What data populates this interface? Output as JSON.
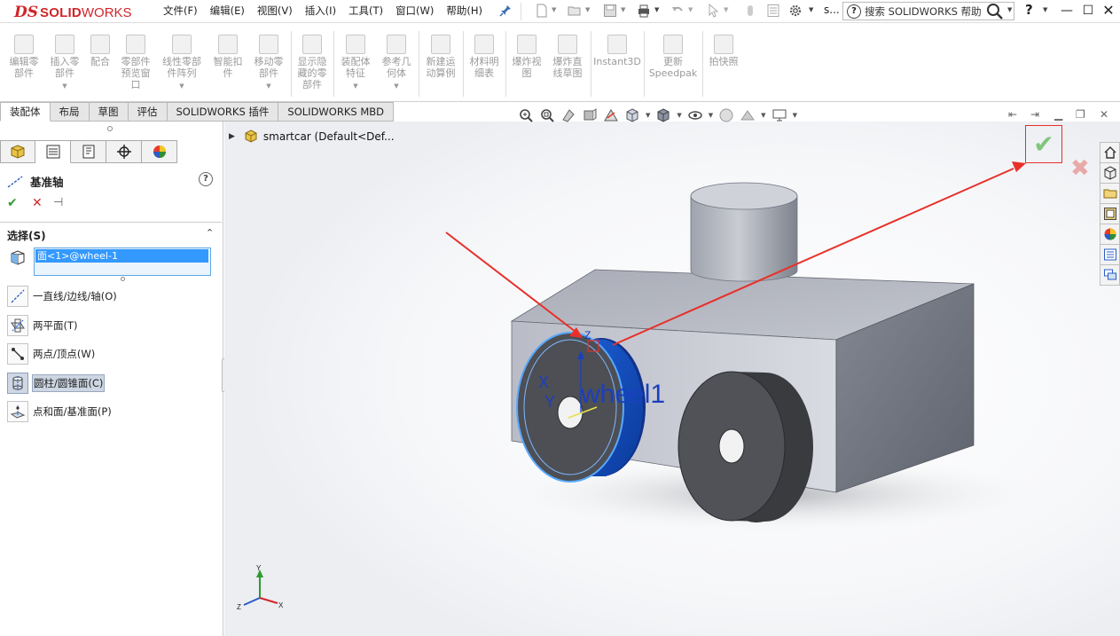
{
  "app": {
    "logo_prefix": "DS",
    "logo_bold": "SOLID",
    "logo_rest": "WORKS"
  },
  "menu": [
    "文件(F)",
    "编辑(E)",
    "视图(V)",
    "插入(I)",
    "工具(T)",
    "窗口(W)",
    "帮助(H)"
  ],
  "titlebar": {
    "doc_short": "s...",
    "search_label": "搜索 SOLIDWORKS 帮助",
    "help_glyph": "?"
  },
  "commands": [
    {
      "label": "编辑零\n部件",
      "dropdown": false
    },
    {
      "label": "插入零\n部件",
      "dropdown": true
    },
    {
      "label": "配合",
      "dropdown": false
    },
    {
      "label": "零部件\n预览窗\n口",
      "dropdown": false
    },
    {
      "label": "线性零部\n件阵列",
      "dropdown": true
    },
    {
      "label": "智能扣\n件",
      "dropdown": false
    },
    {
      "label": "移动零\n部件",
      "dropdown": true
    },
    {
      "label": "显示隐\n藏的零\n部件",
      "dropdown": false
    },
    {
      "label": "装配体\n特征",
      "dropdown": true
    },
    {
      "label": "参考几\n何体",
      "dropdown": true
    },
    {
      "label": "新建运\n动算例",
      "dropdown": false
    },
    {
      "label": "材料明\n细表",
      "dropdown": false
    },
    {
      "label": "爆炸视\n图",
      "dropdown": false
    },
    {
      "label": "爆炸直\n线草图",
      "dropdown": false
    },
    {
      "label": "Instant3D",
      "dropdown": false
    },
    {
      "label": "更新\nSpeedpak",
      "dropdown": false
    },
    {
      "label": "拍快照",
      "dropdown": false
    }
  ],
  "tabs": [
    "装配体",
    "布局",
    "草图",
    "评估",
    "SOLIDWORKS 插件",
    "SOLIDWORKS MBD"
  ],
  "property_manager": {
    "title": "基准轴",
    "help": "?",
    "ok": "✔",
    "cancel": "✕",
    "pin": "⊣",
    "section_title": "选择(S)",
    "collapse": "⌃",
    "selection_value": "面<1>@wheel-1",
    "options": [
      {
        "label": "一直线/边线/轴(O)",
        "active": false
      },
      {
        "label": "两平面(T)",
        "active": false
      },
      {
        "label": "两点/顶点(W)",
        "active": false
      },
      {
        "label": "圆柱/圆锥面(C)",
        "active": true
      },
      {
        "label": "点和面/基准面(P)",
        "active": false
      }
    ]
  },
  "tree": {
    "expander": "▶",
    "item": "smartcar  (Default<Def..."
  },
  "viewport": {
    "triad_labels": {
      "top": "Y",
      "side": "X",
      "left": "Z"
    },
    "axis_label": "wheel1",
    "axis_x": "X",
    "axis_y": "Y",
    "axis_z": "Z",
    "confirm_glyph": "✔",
    "reject_glyph": "✖"
  },
  "colors": {
    "accent_red": "#d0262b",
    "selection_blue": "#3399ff",
    "ok_green": "#2f9b2f",
    "wheel_highlight": "#2a6fdc"
  }
}
